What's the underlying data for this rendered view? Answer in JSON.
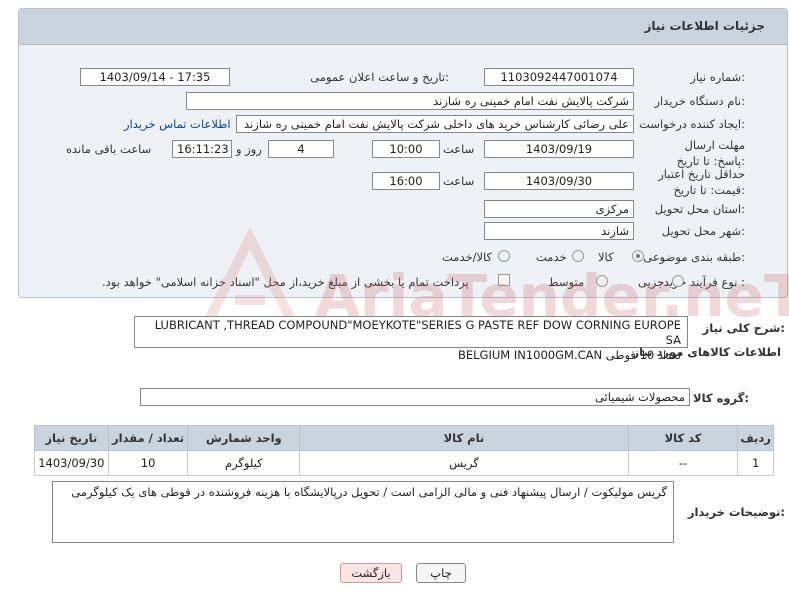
{
  "panel": {
    "title": "جزئیات اطلاعات نیاز"
  },
  "form": {
    "need_number_label": "شماره نیاز:",
    "need_number": "1103092447001074",
    "announce_label": "تاریخ و ساعت اعلان عمومی:",
    "announce_value": "1403/09/14 - 17:35",
    "buyer_label": "نام دستگاه خریدار:",
    "buyer_value": "شرکت پالایش نفت امام خمینی  ره  شازند",
    "creator_label": "ایجاد کننده درخواست:",
    "creator_value": "علی  رضائی کارشناس خرید های داخلی  شرکت پالایش نفت امام خمینی  ره  شازند",
    "contact_link": "اطلاعات تماس خریدار",
    "deadline_label": "مهلت ارسال پاسخ: تا تاریخ:",
    "deadline_date": "1403/09/19",
    "time_label": "ساعت",
    "deadline_time": "10:00",
    "days_value": "4",
    "days_label": "روز و",
    "remaining_value": "16:11:23",
    "remaining_label": "ساعت باقی مانده",
    "validity_label": "حداقل تاریخ اعتبار قیمت: تا تاریخ:",
    "validity_date": "1403/09/30",
    "validity_time": "16:00",
    "province_label": "استان محل تحویل:",
    "province_value": "مرکزی",
    "city_label": "شهر محل تحویل:",
    "city_value": "شازند",
    "category_label": "طبقه بندی موضوعی:",
    "category_options": [
      "کالا",
      "خدمت",
      "کالا/خدمت"
    ],
    "purchase_label": "نوع فرآیند خرید :",
    "purchase_options": [
      "جزیی",
      "متوسط"
    ],
    "payment_note": "پرداخت تمام یا بخشی از مبلغ خرید،از محل \"اسناد خزانه اسلامی\" خواهد بود."
  },
  "summary": {
    "label": "شرح کلی نیاز:",
    "line1": "LUBRICANT ,THREAD COMPOUND\"MOEYKOTE\"SERIES G PASTE REF DOW CORNING EUROPE SA",
    "line2": "BELGIUM IN1000GM.CAN تعداد 10 قوطی"
  },
  "goods": {
    "section_title": "اطلاعات کالاهای مورد نیاز",
    "group_label": "گروه کالا:",
    "group_value": "محصولات شیمیائی",
    "columns": [
      "ردیف",
      "کد کالا",
      "نام کالا",
      "واحد شمارش",
      "تعداد / مقدار",
      "تاریخ نیاز"
    ],
    "rows": [
      [
        "1",
        "--",
        "گریس",
        "کیلوگرم",
        "10",
        "1403/09/30"
      ]
    ]
  },
  "buyer_notes": {
    "label": "توضیحات خریدار:",
    "text": "گریس مولیکوت / ارسال پیشنهاد فنی و مالی الزامی است / تحویل درپالایشگاه با هزینه فروشنده در قوطی های یک کیلوگرمی"
  },
  "buttons": {
    "print": "چاپ",
    "back": "بازگشت"
  },
  "colors": {
    "header_bg": "#c9d4df",
    "panel_bg": "#eef2f6",
    "link": "#0645ad",
    "back_button_bg": "#fbe4e4"
  }
}
